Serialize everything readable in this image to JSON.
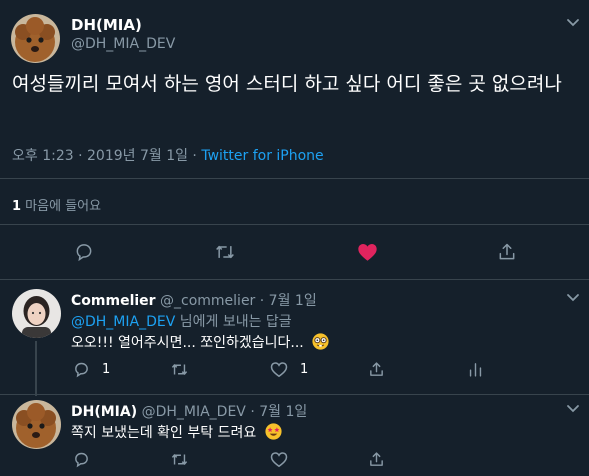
{
  "main": {
    "author_name": "DH(MIA)",
    "author_handle": "@DH_MIA_DEV",
    "text": "여성들끼리 모여서 하는 영어 스터디 하고 싶다 어디 좋은 곳 없으려나",
    "time": "오후 1:23 · 2019년 7월 1일 · ",
    "source": "Twitter for iPhone",
    "likes_count": "1",
    "likes_label": " 마음에 들어요"
  },
  "replies": [
    {
      "author_name": "Commelier",
      "author_handle": "@_commelier",
      "date": "· 7월 1일",
      "reply_to_handle": "@DH_MIA_DEV",
      "reply_to_suffix": " 님에게 보내는 답글",
      "text": "오오!!! 열어주시면... 쪼인하겠습니다...",
      "emoji": "nerd-face",
      "reply_count": "1",
      "like_count": "1"
    },
    {
      "author_name": "DH(MIA)",
      "author_handle": "@DH_MIA_DEV",
      "date": "· 7월 1일",
      "text": "쪽지 보냈는데 확인 부탁 드려요",
      "emoji": "star-struck"
    }
  ],
  "colors": {
    "background": "#15202b",
    "accent": "#1da1f2",
    "like": "#e0245e",
    "muted": "#8899a6",
    "divider": "#38444d"
  }
}
